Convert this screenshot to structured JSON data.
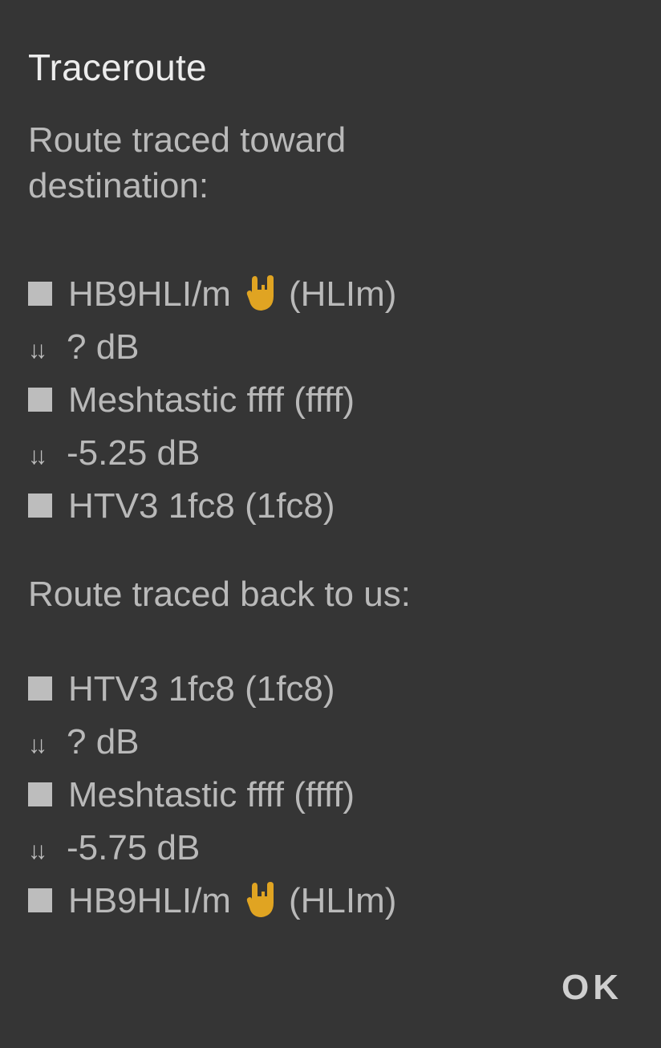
{
  "dialog": {
    "title": "Traceroute",
    "ok_label": "OK"
  },
  "toward": {
    "heading": "Route traced toward destination:",
    "hops": [
      {
        "node": "HB9HLI/m",
        "short": "(HLIm)",
        "emoji": "sign-of-the-horns"
      },
      {
        "snr": "? dB"
      },
      {
        "node": "Meshtastic ffff (ffff)"
      },
      {
        "snr": "-5.25 dB"
      },
      {
        "node": "HTV3 1fc8 (1fc8)"
      }
    ]
  },
  "back": {
    "heading": "Route traced back to us:",
    "hops": [
      {
        "node": "HTV3 1fc8 (1fc8)"
      },
      {
        "snr": "? dB"
      },
      {
        "node": "Meshtastic ffff (ffff)"
      },
      {
        "snr": "-5.75 dB"
      },
      {
        "node": "HB9HLI/m",
        "short": "(HLIm)",
        "emoji": "sign-of-the-horns"
      }
    ]
  },
  "icons": {
    "node_marker": "square-icon",
    "hop_marker": "double-down-arrow-icon",
    "emoji_color": "#E0A422"
  }
}
